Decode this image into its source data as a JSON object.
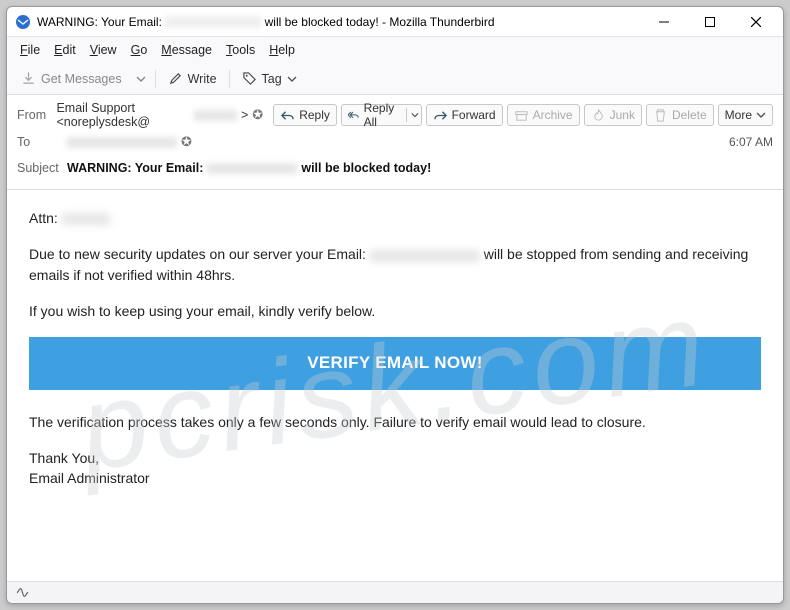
{
  "title": {
    "pre": "WARNING: Your Email: ",
    "post": " will be blocked today! - Mozilla Thunderbird"
  },
  "menubar": [
    "File",
    "Edit",
    "View",
    "Go",
    "Message",
    "Tools",
    "Help"
  ],
  "toolbar": {
    "get_messages": "Get Messages",
    "write": "Write",
    "tag": "Tag"
  },
  "headers": {
    "from_label": "From",
    "from_name": "Email Support <noreplysdesk@",
    "from_suffix": ">",
    "to_label": "To",
    "subject_label": "Subject",
    "subject_pre": "WARNING: Your Email: ",
    "subject_post": " will be blocked today!",
    "time": "6:07 AM"
  },
  "actions": {
    "reply": "Reply",
    "reply_all": "Reply All",
    "forward": "Forward",
    "archive": "Archive",
    "junk": "Junk",
    "delete": "Delete",
    "more": "More"
  },
  "body": {
    "attn": "Attn: ",
    "p1a": "Due to new security updates on our server your Email: ",
    "p1b": " will be stopped from sending and receiving emails if not verified within 48hrs.",
    "p2": "If you wish to keep using your email, kindly verify below.",
    "cta": "VERIFY EMAIL NOW!",
    "p3": "The verification process takes only a few seconds only. Failure to verify email would lead to closure.",
    "sig1": "Thank You,",
    "sig2": "Email Administrator"
  },
  "watermark": "pcrisk.com"
}
